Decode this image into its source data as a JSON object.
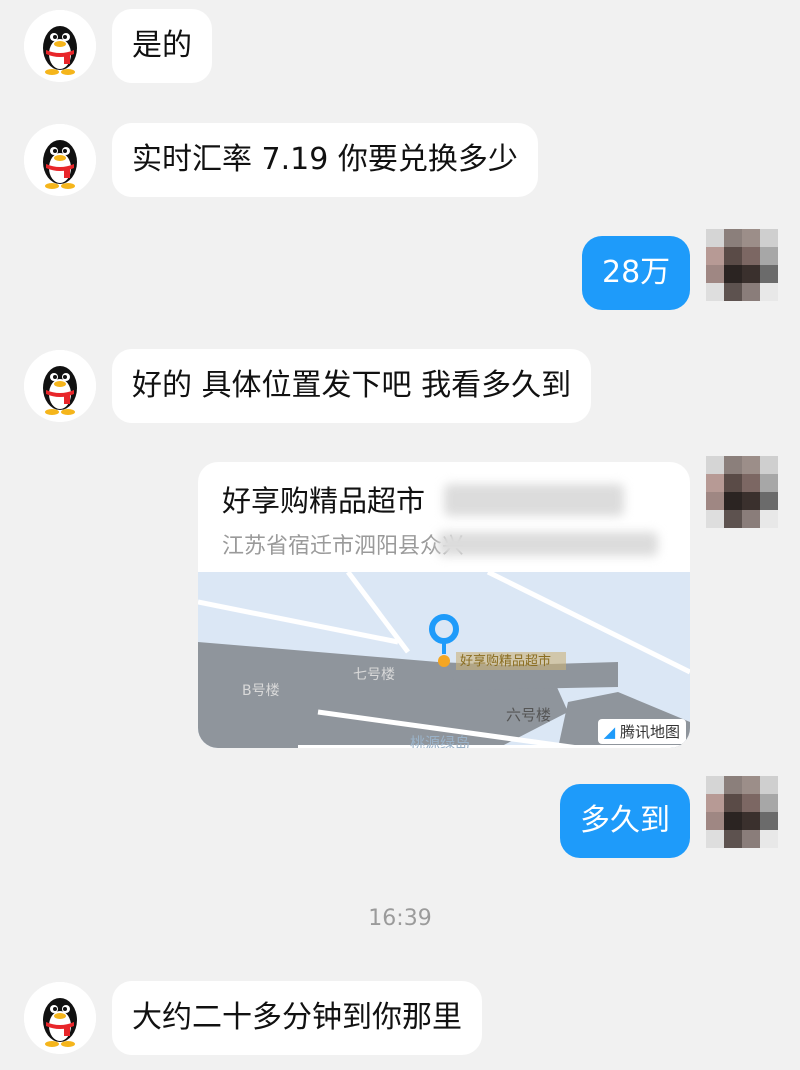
{
  "messages": [
    {
      "side": "left",
      "text": "是的"
    },
    {
      "side": "left",
      "text": "实时汇率 7.19 你要兑换多少"
    },
    {
      "side": "right",
      "text": "28万"
    },
    {
      "side": "left",
      "text": "好的 具体位置发下吧 我看多久到"
    },
    {
      "side": "right",
      "type": "location"
    },
    {
      "side": "right",
      "text": "多久到"
    },
    {
      "side": "left",
      "text": "大约二十多分钟到你那里"
    }
  ],
  "location_card": {
    "title": "好享购精品超市",
    "address": "江苏省宿迁市泗阳县众兴",
    "map_label": "好享购精品超市",
    "building_left": "B号楼",
    "building_mid": "七号楼",
    "building_right": "六号楼",
    "road_label": "桃源绿岛",
    "provider": "腾讯地图"
  },
  "timestamp": "16:39",
  "colors": {
    "background": "#f1f1f1",
    "bubble_self": "#1e9bfa",
    "bubble_other": "#ffffff"
  }
}
